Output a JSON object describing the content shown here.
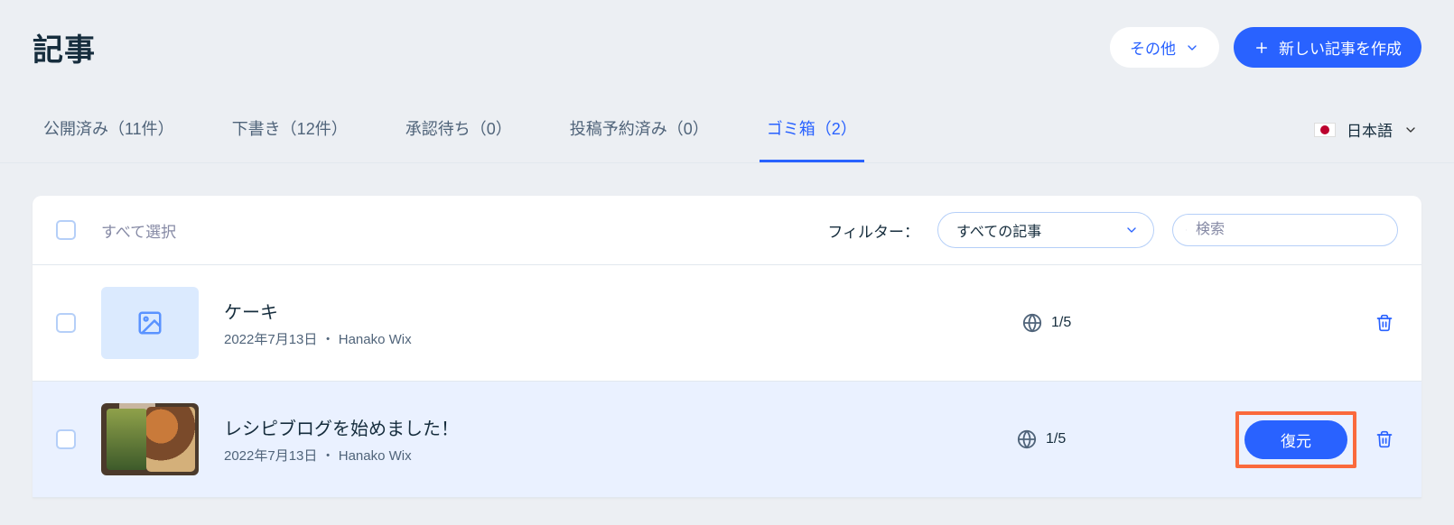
{
  "header": {
    "title": "記事",
    "other_label": "その他",
    "create_label": "新しい記事を作成"
  },
  "tabs": [
    {
      "label": "公開済み（11件）",
      "active": false
    },
    {
      "label": "下書き（12件）",
      "active": false
    },
    {
      "label": "承認待ち（0）",
      "active": false
    },
    {
      "label": "投稿予約済み（0）",
      "active": false
    },
    {
      "label": "ゴミ箱（2）",
      "active": true
    }
  ],
  "language": {
    "label": "日本語"
  },
  "toolbar": {
    "select_all": "すべて選択",
    "filter_label": "フィルター：",
    "filter_value": "すべての記事",
    "search_placeholder": "検索"
  },
  "rows": [
    {
      "title": "ケーキ",
      "meta": "2022年7月13日 ・ Hanako Wix",
      "lang_count": "1/5"
    },
    {
      "title": "レシピブログを始めました！",
      "meta": "2022年7月13日 ・ Hanako Wix",
      "lang_count": "1/5",
      "restore_label": "復元"
    }
  ]
}
